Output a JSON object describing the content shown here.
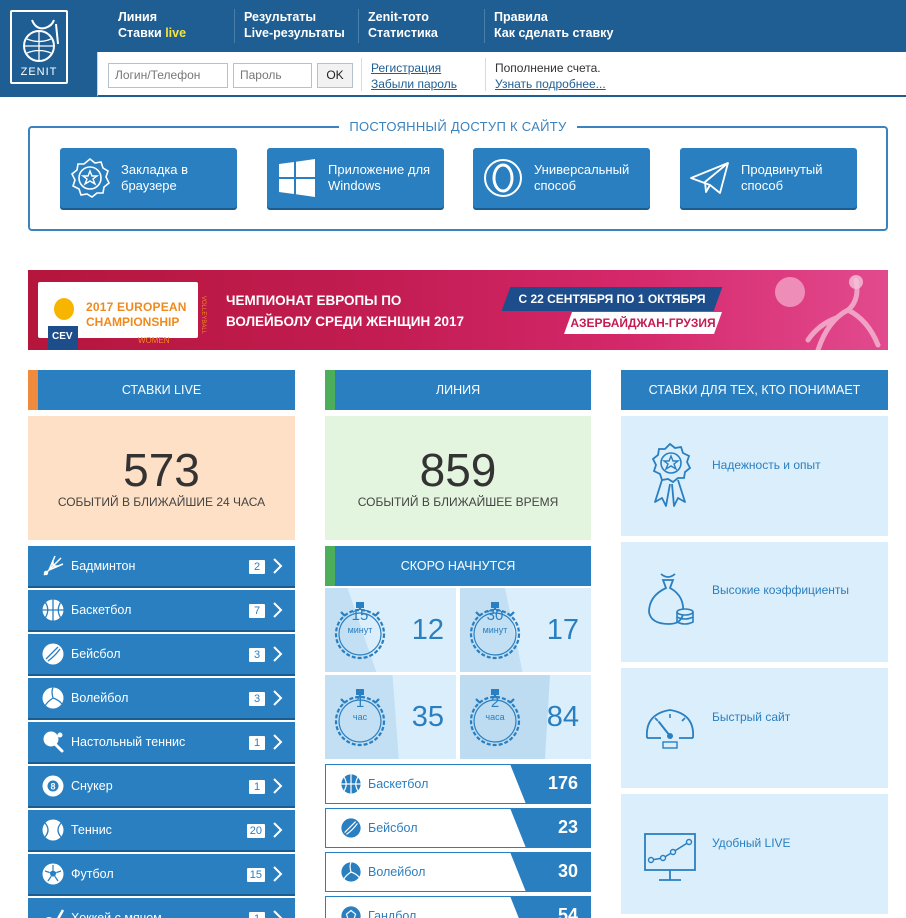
{
  "header": {
    "logo_text": "ZENIT",
    "nav": [
      {
        "line1": "Линия",
        "line2_a": "Ставки ",
        "line2_b": "live"
      },
      {
        "line1": "Результаты",
        "line2": "Live-результаты"
      },
      {
        "line1": "Zenit-тото",
        "line2": "Статистика"
      },
      {
        "line1": "Правила",
        "line2": "Как сделать ставку"
      }
    ],
    "login_placeholder": "Логин/Телефон",
    "password_placeholder": "Пароль",
    "ok_label": "OK",
    "register_link": "Регистрация",
    "forgot_link": "Забыли пароль",
    "topup_text": "Пополнение счета.",
    "learn_more_link": "Узнать подробнее..."
  },
  "access": {
    "title": "ПОСТОЯННЫЙ ДОСТУП К САЙТУ",
    "buttons": [
      {
        "label": "Закладка в браузере",
        "icon": "bookmark-badge-icon"
      },
      {
        "label": "Приложение для Windows",
        "icon": "windows-icon"
      },
      {
        "label": "Универсальный способ",
        "icon": "universal-ring-icon"
      },
      {
        "label": "Продвинутый способ",
        "icon": "paper-plane-icon"
      }
    ]
  },
  "banner": {
    "logo_line1": "2017 EUROPEAN",
    "logo_line2": "CHAMPIONSHIP",
    "logo_line3": "WOMEN",
    "logo_side": "VOLLEYBALL",
    "logo_org": "CEV",
    "title_line1": "ЧЕМПИОНАТ ЕВРОПЫ ПО",
    "title_line2": "ВОЛЕЙБОЛУ СРЕДИ ЖЕНЩИН 2017",
    "dates": "С 22 СЕНТЯБРЯ ПО 1 ОКТЯБРЯ",
    "place": "АЗЕРБАЙДЖАН-ГРУЗИЯ"
  },
  "live": {
    "header": "СТАВКИ LIVE",
    "count": "573",
    "caption": "СОБЫТИЙ В БЛИЖАЙШИЕ 24 ЧАСА",
    "sports": [
      {
        "name": "Бадминтон",
        "count": "2",
        "icon": "shuttlecock-icon"
      },
      {
        "name": "Баскетбол",
        "count": "7",
        "icon": "basketball-icon"
      },
      {
        "name": "Бейсбол",
        "count": "3",
        "icon": "baseball-icon"
      },
      {
        "name": "Волейбол",
        "count": "3",
        "icon": "volleyball-icon"
      },
      {
        "name": "Настольный теннис",
        "count": "1",
        "icon": "table-tennis-icon"
      },
      {
        "name": "Снукер",
        "count": "1",
        "icon": "snooker-ball-icon"
      },
      {
        "name": "Теннис",
        "count": "20",
        "icon": "tennis-ball-icon"
      },
      {
        "name": "Футбол",
        "count": "15",
        "icon": "football-icon"
      },
      {
        "name": "Хоккей с мячом",
        "count": "1",
        "icon": "bandy-icon"
      }
    ]
  },
  "line": {
    "header": "ЛИНИЯ",
    "count": "859",
    "caption": "СОБЫТИЙ В БЛИЖАЙШЕЕ ВРЕМЯ",
    "soon_header": "СКОРО НАЧНУТСЯ",
    "soon": [
      {
        "amount": "15",
        "unit": "минут",
        "count": "12",
        "fill_fraction": 0.25
      },
      {
        "amount": "30",
        "unit": "минут",
        "count": "17",
        "fill_fraction": 0.5
      },
      {
        "amount": "1",
        "unit": "час",
        "count": "35",
        "fill_fraction": 0.75
      },
      {
        "amount": "2",
        "unit": "часа",
        "count": "84",
        "fill_fraction": 1.0
      }
    ],
    "sports": [
      {
        "name": "Баскетбол",
        "count": "176",
        "icon": "basketball-icon"
      },
      {
        "name": "Бейсбол",
        "count": "23",
        "icon": "baseball-icon"
      },
      {
        "name": "Волейбол",
        "count": "30",
        "icon": "volleyball-icon"
      },
      {
        "name": "Гандбол",
        "count": "54",
        "icon": "handball-icon"
      }
    ]
  },
  "pro": {
    "header": "СТАВКИ ДЛЯ ТЕХ, КТО ПОНИМАЕТ",
    "features": [
      {
        "label": "Надежность и опыт",
        "icon": "award-ribbon-icon"
      },
      {
        "label": "Высокие коэффициенты",
        "icon": "money-bag-icon"
      },
      {
        "label": "Быстрый сайт",
        "icon": "speedometer-icon"
      },
      {
        "label": "Удобный LIVE",
        "icon": "live-chart-monitor-icon"
      }
    ]
  },
  "colors": {
    "primary": "#2a7fc0",
    "header_bg": "#1f5e93",
    "live_stat_bg": "#fde0c5",
    "line_stat_bg": "#e3f4df",
    "feature_bg": "#dbeefb",
    "live_accent": "#f08a3c",
    "line_accent": "#4cae5a",
    "live_highlight": "#f6e33b"
  }
}
